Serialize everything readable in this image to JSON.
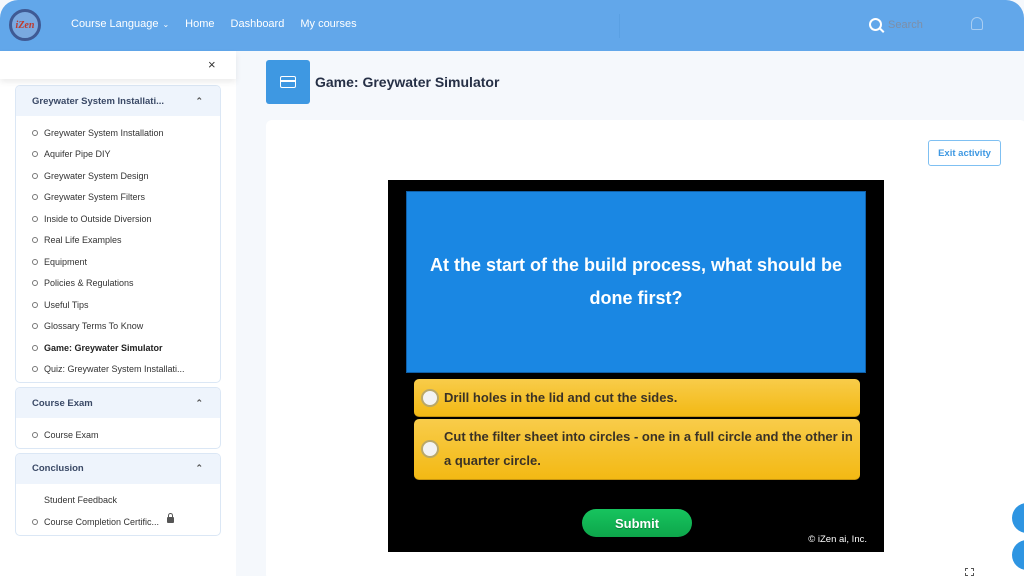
{
  "navbar": {
    "logo_text": "iZen",
    "links": [
      {
        "label": "Course Language",
        "has_dropdown": true
      },
      {
        "label": "Home"
      },
      {
        "label": "Dashboard"
      },
      {
        "label": "My courses"
      }
    ],
    "search_placeholder": "Search",
    "icons": {
      "search": "search-icon",
      "notifications": "bell-icon"
    }
  },
  "sidebar": {
    "close_label": "×",
    "sections": [
      {
        "title": "Greywater System Installati...",
        "expanded": true,
        "items": [
          {
            "label": "Greywater System Installation"
          },
          {
            "label": "Aquifer Pipe DIY"
          },
          {
            "label": "Greywater System Design"
          },
          {
            "label": "Greywater System Filters"
          },
          {
            "label": "Inside to Outside Diversion"
          },
          {
            "label": "Real Life Examples"
          },
          {
            "label": "Equipment"
          },
          {
            "label": "Policies & Regulations"
          },
          {
            "label": "Useful Tips"
          },
          {
            "label": "Glossary Terms To Know"
          },
          {
            "label": "Game: Greywater Simulator",
            "active": true
          },
          {
            "label": "Quiz: Greywater System Installati..."
          }
        ]
      },
      {
        "title": "Course Exam",
        "expanded": true,
        "items": [
          {
            "label": "Course Exam"
          }
        ]
      },
      {
        "title": "Conclusion",
        "expanded": true,
        "items": [
          {
            "label": "Student Feedback",
            "no_status": true
          },
          {
            "label": "Course Completion Certific...",
            "locked": true
          }
        ]
      }
    ]
  },
  "main": {
    "page_title": "Game: Greywater Simulator",
    "title_icon": "box-icon",
    "exit_button": "Exit activity",
    "game": {
      "question": "At the start of the build process, what should be done first?",
      "options": [
        "Drill holes in the lid and cut the sides.",
        "Cut the filter sheet into circles - one in a full circle and the other in a quarter circle."
      ],
      "submit_label": "Submit",
      "copyright": "© iZen ai, Inc."
    }
  },
  "colors": {
    "navbar": "#62a7ea",
    "accent": "#3e98e2",
    "question_bg": "#1a87e3",
    "option_bg": "#f5c12a",
    "submit_bg": "#12b655"
  }
}
